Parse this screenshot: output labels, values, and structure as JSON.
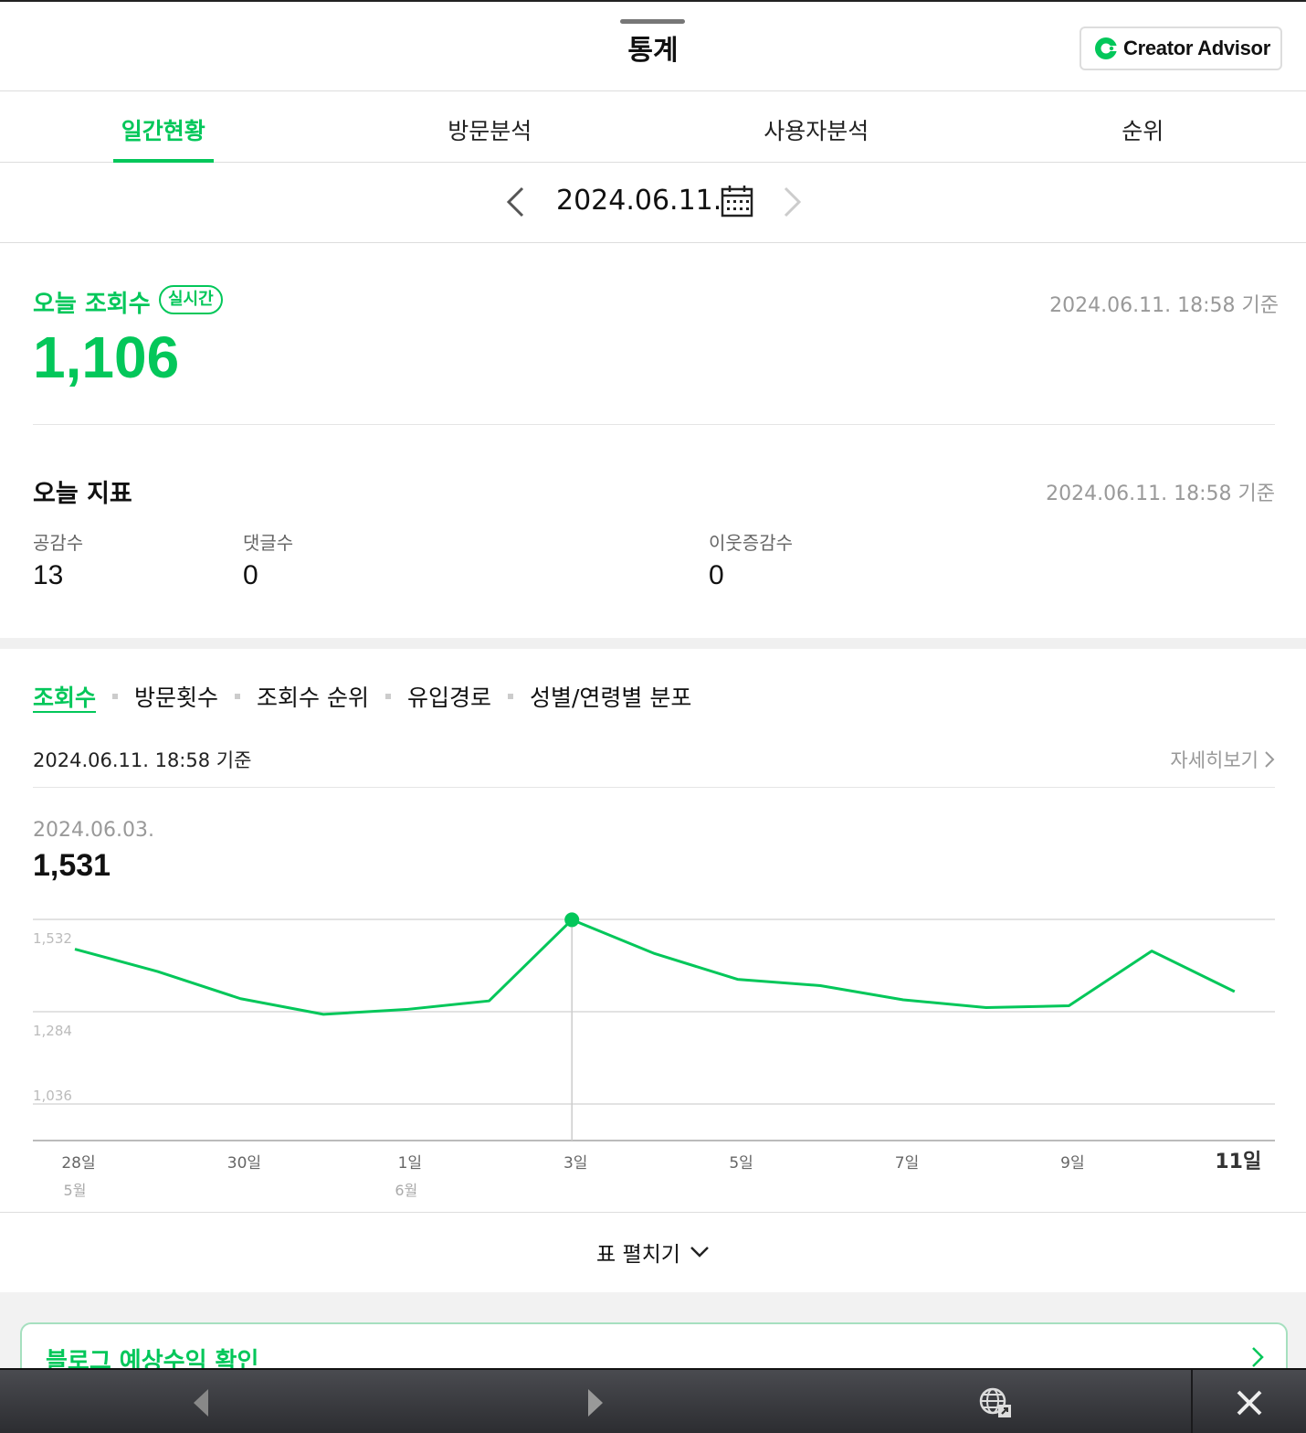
{
  "header": {
    "title": "통계",
    "creator_advisor_label": "Creator Advisor"
  },
  "tabs": [
    {
      "label": "일간현황",
      "active": true
    },
    {
      "label": "방문분석",
      "active": false
    },
    {
      "label": "사용자분석",
      "active": false
    },
    {
      "label": "순위",
      "active": false
    }
  ],
  "date_nav": {
    "date": "2024.06.11."
  },
  "today_views": {
    "label": "오늘 조회수",
    "badge": "실시간",
    "basis": "2024.06.11. 18:58 기준",
    "value": "1,106"
  },
  "indicators": {
    "title": "오늘 지표",
    "basis": "2024.06.11. 18:58 기준",
    "metrics": [
      {
        "label": "공감수",
        "value": "13"
      },
      {
        "label": "댓글수",
        "value": "0"
      },
      {
        "label": "이웃증감수",
        "value": "0"
      }
    ]
  },
  "subtabs": [
    {
      "label": "조회수",
      "active": true
    },
    {
      "label": "방문횟수",
      "active": false
    },
    {
      "label": "조회수 순위",
      "active": false
    },
    {
      "label": "유입경로",
      "active": false
    },
    {
      "label": "성별/연령별 분포",
      "active": false
    }
  ],
  "chart_section": {
    "basis": "2024.06.11. 18:58 기준",
    "detail_link": "자세히보기",
    "selected_date": "2024.06.03.",
    "selected_value": "1,531",
    "expand_label": "표 펼치기"
  },
  "chart_data": {
    "type": "line",
    "series": [
      {
        "values": [
          1452,
          1392,
          1319,
          1277,
          1290,
          1313,
          1531,
          1440,
          1371,
          1354,
          1316,
          1295,
          1300,
          1447,
          1338
        ]
      }
    ],
    "x": [
      "5/28",
      "5/29",
      "5/30",
      "5/31",
      "6/1",
      "6/2",
      "6/3",
      "6/4",
      "6/5",
      "6/6",
      "6/7",
      "6/8",
      "6/9",
      "6/10",
      "6/11"
    ],
    "tick_labels": [
      {
        "day": "28일",
        "month": "5월"
      },
      {
        "day": "30일",
        "month": ""
      },
      {
        "day": "1일",
        "month": "6월"
      },
      {
        "day": "3일",
        "month": ""
      },
      {
        "day": "5일",
        "month": ""
      },
      {
        "day": "7일",
        "month": ""
      },
      {
        "day": "9일",
        "month": ""
      },
      {
        "day": "11일",
        "month": ""
      }
    ],
    "y_ticks": [
      "1,532",
      "1,284",
      "1,036"
    ],
    "ylim": [
      1036,
      1532
    ],
    "selected_index": 6,
    "line_color": "#03c75a",
    "grid": true
  },
  "revenue_card": {
    "title": "블로그 예상수익 확인"
  },
  "colors": {
    "accent": "#03c75a",
    "muted_text": "#999999"
  }
}
